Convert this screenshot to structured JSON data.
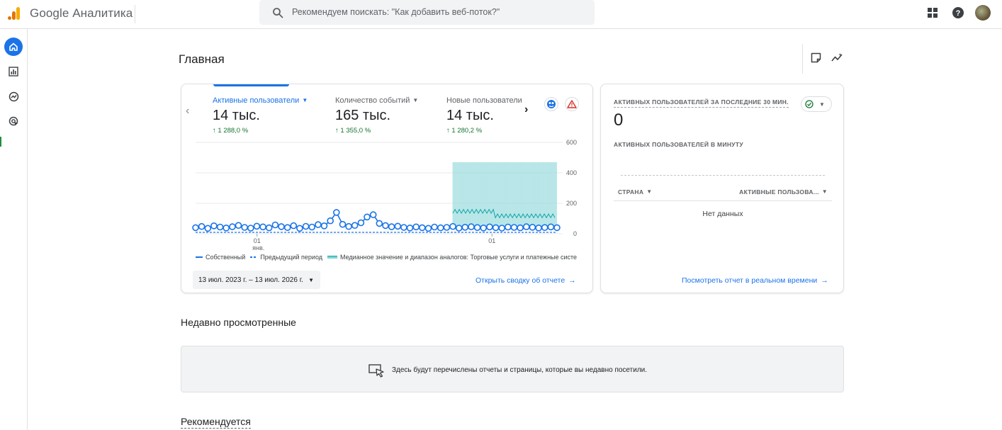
{
  "app": {
    "name": "Google Аналитика"
  },
  "search": {
    "placeholder": "Рекомендуем поискать: \"Как добавить веб-поток?\""
  },
  "page": {
    "title": "Главная"
  },
  "metrics": [
    {
      "label": "Активные пользователи",
      "value": "14 тыс.",
      "delta": "1 288,0 %",
      "active": true
    },
    {
      "label": "Количество событий",
      "value": "165 тыс.",
      "delta": "1 355,0 %",
      "active": false
    },
    {
      "label": "Новые пользователи",
      "value": "14 тыс.",
      "delta": "1 280,2 %",
      "active": false
    }
  ],
  "chart_data": {
    "type": "line",
    "y_ticks": [
      "600",
      "400",
      "200",
      "0"
    ],
    "ylim": [
      0,
      600
    ],
    "x_ticks": [
      {
        "day": "01",
        "month": "янв."
      },
      {
        "day": "01",
        "month": ""
      }
    ],
    "grid": true,
    "legend_position": "bottom",
    "series": [
      {
        "name": "Собственный",
        "style": "solid",
        "color": "#1a73e8"
      },
      {
        "name": "Предыдущий период",
        "style": "dashed",
        "color": "#1a73e8"
      },
      {
        "name": "Медианное значение и диапазон аналогов: Торговые услуги и платежные систе",
        "style": "band",
        "color": "#12a4a8"
      }
    ],
    "own_daily_approx": [
      40,
      48,
      36,
      52,
      44,
      38,
      46,
      55,
      42,
      37,
      50,
      45,
      39,
      58,
      47,
      41,
      53,
      36,
      49,
      44,
      60,
      52,
      85,
      140,
      62,
      48,
      55,
      72,
      110,
      125,
      68,
      54,
      46,
      50,
      42,
      38,
      45,
      40,
      36,
      44,
      39,
      42,
      48,
      37,
      43,
      46,
      41,
      38,
      45,
      40,
      37,
      44,
      42,
      39,
      46,
      43,
      38,
      41,
      45,
      40
    ],
    "peer_median_approx": 140,
    "peer_band_upper_approx": 470
  },
  "actions": {
    "date_range": "13 июл. 2023 г. – 13 июл. 2026 г.",
    "open_report": "Открыть сводку об отчете",
    "realtime_report": "Посмотреть отчет в реальном времени"
  },
  "realtime": {
    "title": "АКТИВНЫХ ПОЛЬЗОВАТЕЛЕЙ ЗА ПОСЛЕДНИЕ 30 МИН.",
    "value": "0",
    "per_minute": "АКТИВНЫХ ПОЛЬЗОВАТЕЛЕЙ В МИНУТУ",
    "col_country": "СТРАНА",
    "col_users": "АКТИВНЫЕ ПОЛЬЗОВА...",
    "empty": "Нет данных"
  },
  "recent": {
    "title": "Недавно просмотренные",
    "empty_text": "Здесь будут перечислены отчеты и страницы, которые вы недавно посетили."
  },
  "recommended": {
    "title": "Рекомендуется"
  },
  "colors": {
    "accent": "#1a73e8",
    "positive": "#137333",
    "peer_band": "#7fd3d5",
    "peer_line": "#12a4a8",
    "warning": "#d93025"
  }
}
